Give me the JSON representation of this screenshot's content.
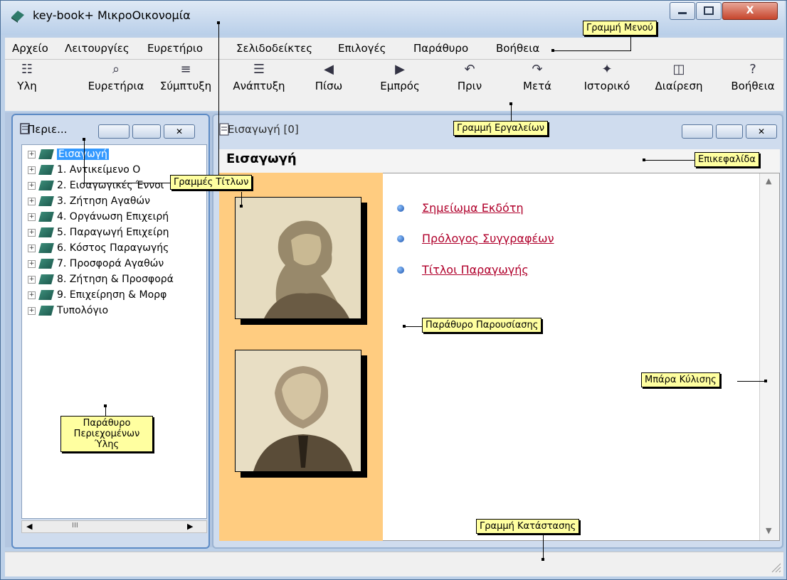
{
  "window": {
    "title": "key-book+  ΜικροΟικονομία",
    "close_label": "X"
  },
  "menu": [
    "Αρχείο",
    "Λειτουργίες",
    "Ευρετήριο",
    "Σελιδοδείκτες",
    "Επιλογές",
    "Παράθυρο",
    "Βοήθεια"
  ],
  "toolbar": [
    {
      "label": "Υλη",
      "icon": "book-list-icon"
    },
    {
      "label": "Ευρετήρια",
      "icon": "magnifier-icon"
    },
    {
      "label": "Σύμπτυξη",
      "icon": "collapse-icon"
    },
    {
      "label": "Ανάπτυξη",
      "icon": "expand-icon"
    },
    {
      "label": "Πίσω",
      "icon": "back-arrow-icon"
    },
    {
      "label": "Εμπρός",
      "icon": "forward-arrow-icon"
    },
    {
      "label": "Πριν",
      "icon": "undo-icon"
    },
    {
      "label": "Μετά",
      "icon": "redo-icon"
    },
    {
      "label": "Ιστορικό",
      "icon": "history-icon"
    },
    {
      "label": "Διαίρεση",
      "icon": "split-icon"
    },
    {
      "label": "Βοήθεια",
      "icon": "help-icon"
    }
  ],
  "left_panel": {
    "title": "Περιε...",
    "tree": [
      "Εισαγωγή",
      "1. Αντικείμενο Ο",
      "2. Εισαγωγικές Έννοι",
      "3. Ζήτηση Αγαθών",
      "4. Οργάνωση Επιχειρή",
      "5. Παραγωγή Επιχείρη",
      "6. Κόστος Παραγωγής",
      "7. Προσφορά Αγαθών",
      "8. Ζήτηση & Προσφορά",
      "9. Επιχείρηση & Μορφ",
      "Τυπολόγιο"
    ],
    "selected_index": 0,
    "scroll_thumb_label": "III"
  },
  "right_panel": {
    "title": "Εισαγωγή  [0]",
    "heading": "Εισαγωγή",
    "links": [
      "Σημείωμα Εκδότη",
      "Πρόλογος Συγγραφέων",
      "Τίτλοι Παραγωγής"
    ]
  },
  "callouts": {
    "menu": "Γραμμή Μενού",
    "titles": "Γραμμές Τίτλων",
    "toolbar": "Γραμμή Εργαλείων",
    "heading": "Επικεφαλίδα",
    "presentation": "Παράθυρο Παρουσίασης",
    "scrollbar": "Μπάρα Κύλισης",
    "contents_line1": "Παράθυρο",
    "contents_line2": "Περιεχομένων",
    "contents_line3": "Ύλης",
    "status": "Γραμμή Κατάστασης"
  },
  "colors": {
    "accent": "#3399ff",
    "link": "#b0002b",
    "portrait_bg": "#ffcc80",
    "callout_bg": "#ffffa0"
  }
}
